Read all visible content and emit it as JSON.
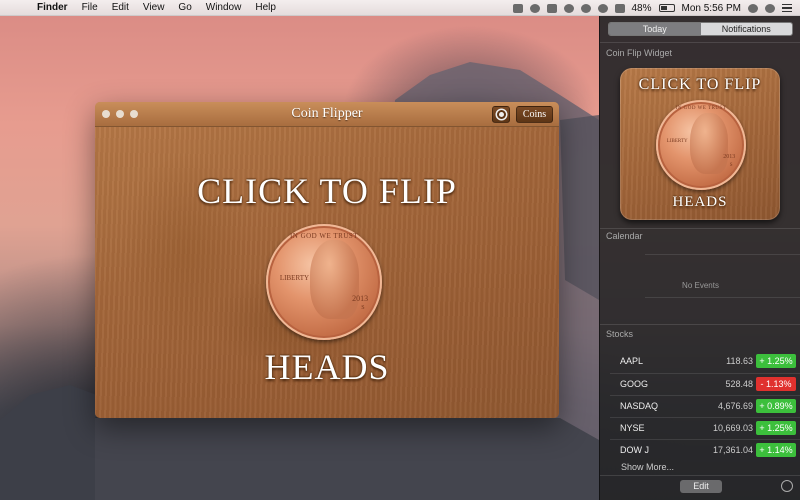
{
  "menubar": {
    "app_name": "Finder",
    "items": [
      "File",
      "Edit",
      "View",
      "Go",
      "Window",
      "Help"
    ],
    "battery": "48%",
    "clock": "Mon 5:56 PM"
  },
  "window": {
    "title": "Coin Flipper",
    "coins_label": "Coins",
    "headline": "CLICK TO FLIP",
    "result": "HEADS",
    "coin": {
      "motto": "IN GOD WE TRUST",
      "liberty": "LIBERTY",
      "year": "2013",
      "mint": "S"
    }
  },
  "notification_center": {
    "tabs": [
      {
        "label": "Today",
        "active": false
      },
      {
        "label": "Notifications",
        "active": true
      }
    ],
    "widget": {
      "title": "Coin Flip Widget",
      "headline": "CLICK TO FLIP",
      "result": "HEADS",
      "coin": {
        "motto": "IN GOD WE TRUST",
        "liberty": "LIBERTY",
        "year": "2013",
        "mint": "S"
      }
    },
    "calendar": {
      "title": "Calendar",
      "empty_text": "No Events"
    },
    "stocks": {
      "title": "Stocks",
      "rows": [
        {
          "symbol": "AAPL",
          "price": "118.63",
          "change": "+ 1.25%",
          "direction": "up"
        },
        {
          "symbol": "GOOG",
          "price": "528.48",
          "change": "- 1.13%",
          "direction": "down"
        },
        {
          "symbol": "NASDAQ",
          "price": "4,676.69",
          "change": "+ 0.89%",
          "direction": "up"
        },
        {
          "symbol": "NYSE",
          "price": "10,669.03",
          "change": "+ 1.25%",
          "direction": "up"
        },
        {
          "symbol": "DOW J",
          "price": "17,361.04",
          "change": "+ 1.14%",
          "direction": "up"
        }
      ],
      "show_more": "Show More..."
    },
    "edit_label": "Edit"
  },
  "colors": {
    "up": "#3cbf3c",
    "down": "#e0312e"
  }
}
